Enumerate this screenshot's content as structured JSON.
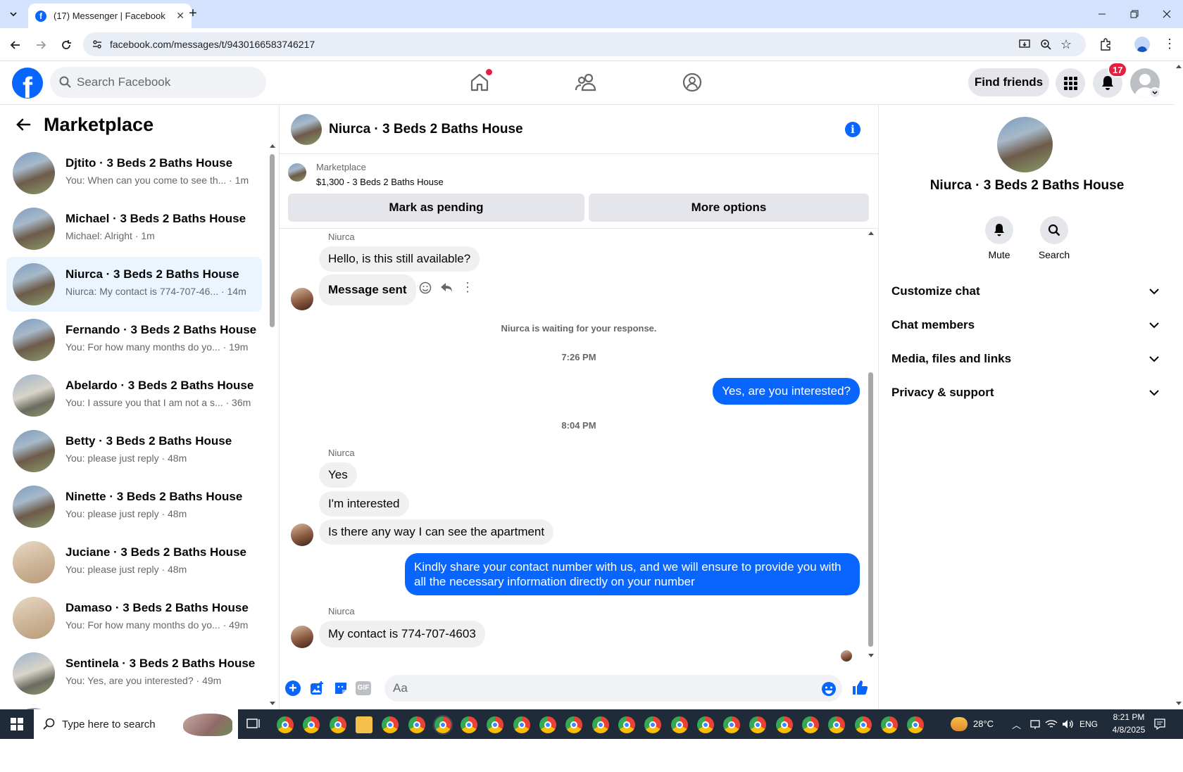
{
  "browser": {
    "tab_title": "(17) Messenger | Facebook",
    "url": "facebook.com/messages/t/9430166583746217"
  },
  "header": {
    "search_placeholder": "Search Facebook",
    "find_friends": "Find friends",
    "notifications_count": "17"
  },
  "sidebar": {
    "title": "Marketplace",
    "conversations": [
      {
        "name": "Djtito · 3 Beds 2 Baths House",
        "snippet": "You: When can you come to see th... · 1m",
        "thumb": "exterior"
      },
      {
        "name": "Michael · 3 Beds 2 Baths House",
        "snippet": "Michael: Alright · 1m",
        "thumb": "exterior"
      },
      {
        "name": "Niurca · 3 Beds 2 Baths House",
        "snippet": "Niurca: My contact is 774-707-46... · 14m",
        "thumb": "exterior",
        "active": true
      },
      {
        "name": "Fernando · 3 Beds 2 Baths House",
        "snippet": "You: For how many months do yo... · 19m",
        "thumb": "exterior"
      },
      {
        "name": "Abelardo · 3 Beds 2 Baths House",
        "snippet": "You: I assure you that I am not a s... · 36m",
        "thumb": "exterior2"
      },
      {
        "name": "Betty · 3 Beds 2 Baths House",
        "snippet": "You: please just reply · 48m",
        "thumb": "exterior"
      },
      {
        "name": "Ninette · 3 Beds 2 Baths House",
        "snippet": "You: please just reply · 48m",
        "thumb": "exterior"
      },
      {
        "name": "Juciane · 3 Beds 2 Baths House",
        "snippet": "You: please just reply · 48m",
        "thumb": "interior"
      },
      {
        "name": "Damaso · 3 Beds 2 Baths House",
        "snippet": "You: For how many months do yo... · 49m",
        "thumb": "interior"
      },
      {
        "name": "Sentinela · 3 Beds 2 Baths House",
        "snippet": "You: Yes, are you interested? · 49m",
        "thumb": "exterior2"
      }
    ]
  },
  "chat": {
    "title": "Niurca · 3 Beds 2 Baths House",
    "listing_label": "Marketplace",
    "listing_price": "$1,300 - 3 Beds 2 Baths House",
    "mark_pending": "Mark as pending",
    "more_options": "More options",
    "sender_name": "Niurca",
    "msg1": "Hello, is this still available?",
    "msg2": "Message sent",
    "waiting": "Niurca is waiting for your response.",
    "time1": "7:26 PM",
    "out1": "Yes, are you interested?",
    "time2": "8:04 PM",
    "msg3": "Yes",
    "msg4": "I'm interested",
    "msg5": "Is there any way I can see the apartment",
    "out2": "Kindly share your contact number with us, and we will ensure to provide you with all the necessary information directly on your number",
    "msg6": "My contact is 774-707-4603",
    "composer_placeholder": "Aa"
  },
  "details": {
    "name": "Niurca · 3 Beds 2 Baths House",
    "mute": "Mute",
    "search": "Search",
    "sections": [
      "Customize chat",
      "Chat members",
      "Media, files and links",
      "Privacy & support"
    ]
  },
  "taskbar": {
    "search_placeholder": "Type here to search",
    "weather": "28°C",
    "language": "ENG",
    "time": "8:21 PM",
    "date": "4/8/2025"
  },
  "colors": {
    "accent": "#0866ff",
    "fb_blue": "#0866ff",
    "badge_red": "#e41e3f"
  }
}
